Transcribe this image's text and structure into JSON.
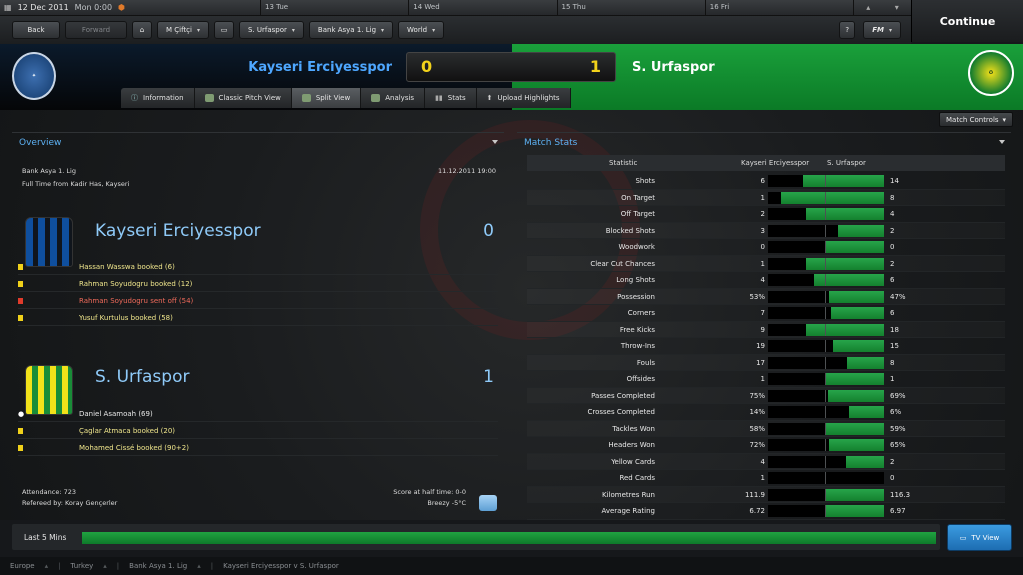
{
  "calendar": {
    "date": "12 Dec 2011",
    "time": "Mon 0:00",
    "days": [
      "13 Tue",
      "14 Wed",
      "15 Thu",
      "16 Fri"
    ]
  },
  "continue_label": "Continue",
  "nav": {
    "back": "Back",
    "forward": "Forward",
    "manager": "M Çiftçi",
    "club": "S. Urfaspor",
    "league": "Bank Asya 1. Lig",
    "world": "World",
    "help": "?",
    "fm": "FM"
  },
  "match": {
    "home": "Kayseri Erciyesspor",
    "away": "S. Urfaspor",
    "home_score": "0",
    "away_score": "1"
  },
  "tabs": [
    "Information",
    "Classic Pitch View",
    "Split View",
    "Analysis",
    "Stats",
    "Upload Highlights"
  ],
  "match_controls": "Match Controls",
  "overview": {
    "title": "Overview",
    "competition": "Bank Asya 1. Lig",
    "fulltime": "Full Time from Kadir Has, Kayseri",
    "datetime": "11.12.2011 19:00",
    "home_events": [
      {
        "type": "yellow",
        "text": "Hassan Wasswa booked (6)"
      },
      {
        "type": "yellow",
        "text": "Rahman Soyudogru booked (12)"
      },
      {
        "type": "red",
        "text": "Rahman Soyudogru sent off (54)"
      },
      {
        "type": "yellow",
        "text": "Yusuf Kurtulus booked (58)"
      }
    ],
    "away_events": [
      {
        "type": "goal",
        "text": "Daniel Asamoah (69)"
      },
      {
        "type": "yellow",
        "text": "Çaglar Atmaca booked (20)"
      },
      {
        "type": "yellow",
        "text": "Mohamed Cissé booked (90+2)"
      }
    ],
    "attendance": "Attendance: 723",
    "referee": "Refereed by: Koray Gençerler",
    "halftime": "Score at half time: 0-0",
    "weather": "Breezy -5°C"
  },
  "stats": {
    "title": "Match Stats",
    "headers": {
      "statistic": "Statistic",
      "home": "Kayseri Erciyesspor",
      "away": "S. Urfaspor"
    },
    "rows": [
      {
        "label": "Shots",
        "home": "6",
        "away": "14",
        "share": 0.7
      },
      {
        "label": "On Target",
        "home": "1",
        "away": "8",
        "share": 0.89
      },
      {
        "label": "Off Target",
        "home": "2",
        "away": "4",
        "share": 0.67
      },
      {
        "label": "Blocked Shots",
        "home": "3",
        "away": "2",
        "share": 0.4
      },
      {
        "label": "Woodwork",
        "home": "0",
        "away": "0",
        "share": 0.5
      },
      {
        "label": "Clear Cut Chances",
        "home": "1",
        "away": "2",
        "share": 0.67
      },
      {
        "label": "Long Shots",
        "home": "4",
        "away": "6",
        "share": 0.6
      },
      {
        "label": "Possession",
        "home": "53%",
        "away": "47%",
        "share": 0.47
      },
      {
        "label": "Corners",
        "home": "7",
        "away": "6",
        "share": 0.46
      },
      {
        "label": "Free Kicks",
        "home": "9",
        "away": "18",
        "share": 0.67
      },
      {
        "label": "Throw-Ins",
        "home": "19",
        "away": "15",
        "share": 0.44
      },
      {
        "label": "Fouls",
        "home": "17",
        "away": "8",
        "share": 0.32
      },
      {
        "label": "Offsides",
        "home": "1",
        "away": "1",
        "share": 0.5
      },
      {
        "label": "Passes Completed",
        "home": "75%",
        "away": "69%",
        "share": 0.48
      },
      {
        "label": "Crosses Completed",
        "home": "14%",
        "away": "6%",
        "share": 0.3
      },
      {
        "label": "Tackles Won",
        "home": "58%",
        "away": "59%",
        "share": 0.5
      },
      {
        "label": "Headers Won",
        "home": "72%",
        "away": "65%",
        "share": 0.47
      },
      {
        "label": "Yellow Cards",
        "home": "4",
        "away": "2",
        "share": 0.33
      },
      {
        "label": "Red Cards",
        "home": "1",
        "away": "0",
        "share": 0.0
      },
      {
        "label": "Kilometres Run",
        "home": "111.9",
        "away": "116.3",
        "share": 0.51
      },
      {
        "label": "Average Rating",
        "home": "6.72",
        "away": "6.97",
        "share": 0.51
      }
    ]
  },
  "last5": {
    "label": "Last 5 Mins",
    "away_share": 1.0
  },
  "tv_view": "TV View",
  "breadcrumbs": [
    "Europe",
    "Turkey",
    "Bank Asya 1. Lig",
    "Kayseri Erciyesspor v S. Urfaspor"
  ],
  "colors": {
    "home": "#4ea7ff",
    "away": "#1aa03b",
    "score": "#f2d21b"
  }
}
